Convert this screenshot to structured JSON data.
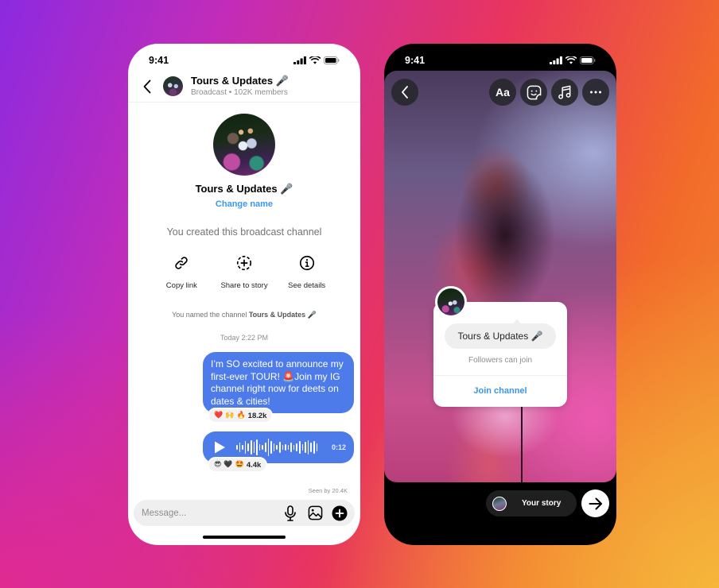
{
  "colors": {
    "accent_blue": "#3897f0",
    "bubble_blue": "#4d7cea",
    "bg_gradient": [
      "#8c2ae0",
      "#e4288c",
      "#e8345e",
      "#f26a2a",
      "#f6b83c"
    ]
  },
  "chat_phone": {
    "status_bar": {
      "time": "9:41"
    },
    "header": {
      "back_icon": "chevron-left-icon",
      "title": "Tours & Updates 🎤",
      "subtitle": "Broadcast • 102K members"
    },
    "profile": {
      "name": "Tours & Updates 🎤",
      "change_name_label": "Change name",
      "created_text": "You created this broadcast channel"
    },
    "actions": [
      {
        "label": "Copy link",
        "icon": "link-icon"
      },
      {
        "label": "Share to story",
        "icon": "add-story-icon"
      },
      {
        "label": "See details",
        "icon": "info-icon"
      }
    ],
    "named_note": {
      "prefix": "You named the channel ",
      "channel": "Tours & Updates 🎤"
    },
    "timestamp": "Today 2:22 PM",
    "messages": [
      {
        "type": "text",
        "text": "I’m SO excited to announce my first-ever TOUR! 🚨Join my IG channel right now for deets on dates & cities!",
        "reactions": {
          "emojis": [
            "❤️",
            "🙌",
            "🔥"
          ],
          "count": "18.2k"
        }
      },
      {
        "type": "voice",
        "duration": "0:12",
        "reactions": {
          "emojis": [
            "😎",
            "🖤",
            "🤩"
          ],
          "count": "4.4k"
        }
      }
    ],
    "seen_by": "Seen by 20.4K",
    "composer": {
      "placeholder": "Message...",
      "icons": [
        "microphone-icon",
        "gallery-icon",
        "plus-icon"
      ]
    }
  },
  "story_phone": {
    "status_bar": {
      "time": "9:41"
    },
    "toolbar": {
      "back_icon": "chevron-left-icon",
      "text_tool_label": "Aa",
      "tools": [
        "text-icon",
        "sticker-icon",
        "music-icon",
        "more-icon"
      ]
    },
    "sticker": {
      "channel_name": "Tours & Updates 🎤",
      "subtitle": "Followers can join",
      "join_label": "Join channel"
    },
    "share": {
      "your_story_label": "Your story",
      "send_icon": "arrow-right-icon"
    }
  }
}
